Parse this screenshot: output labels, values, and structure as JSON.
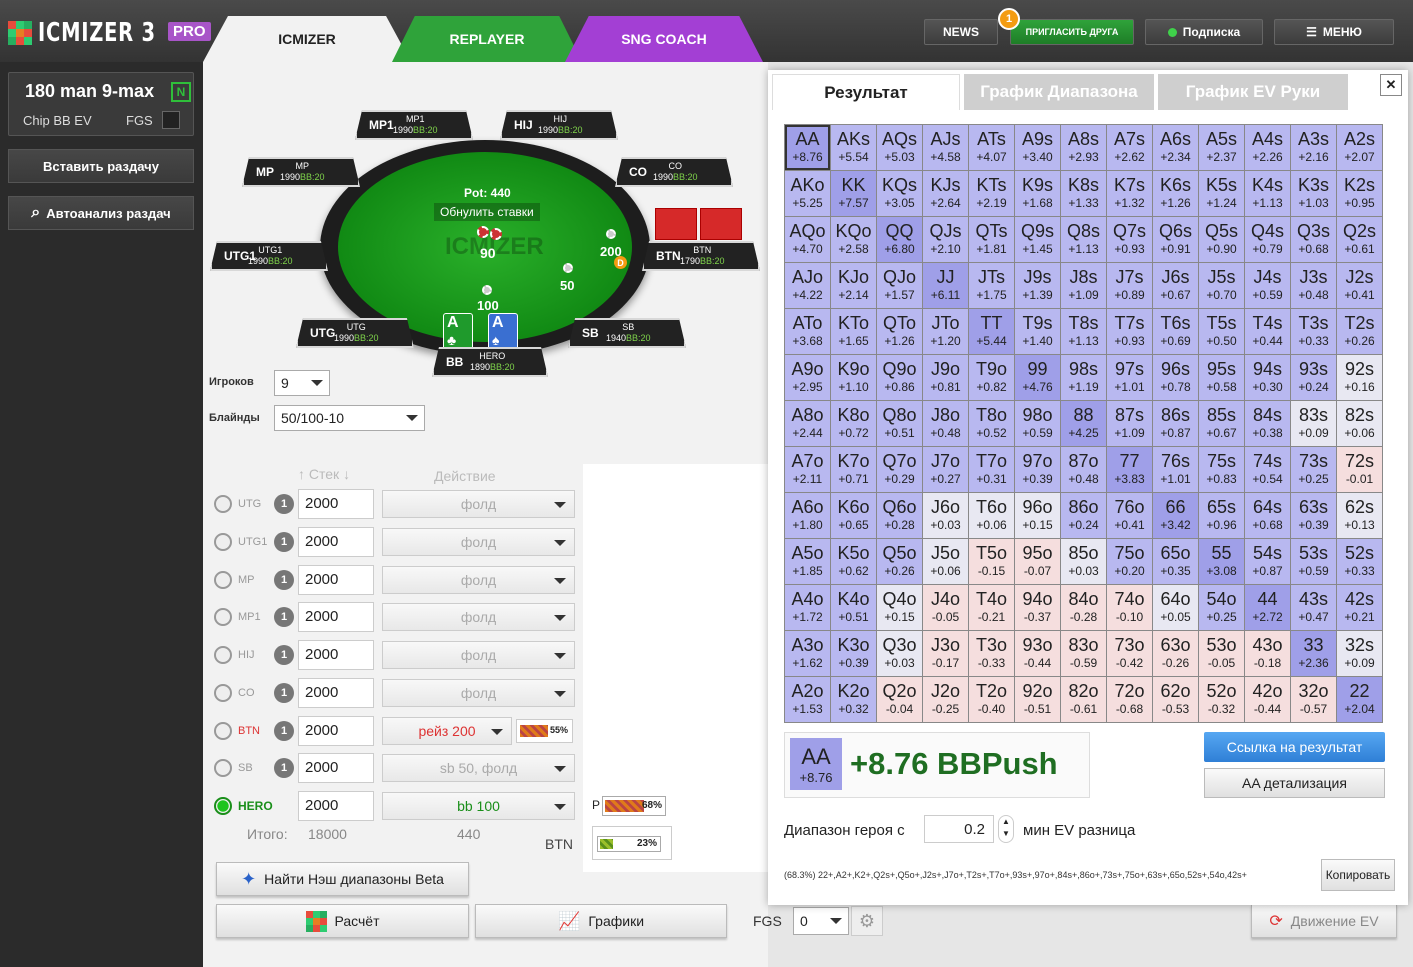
{
  "app": {
    "logo": "ICMIZER 3",
    "pro": "PRO"
  },
  "tabs": [
    "ICMIZER",
    "REPLAYER",
    "SNG COACH"
  ],
  "topbar": {
    "news": "NEWS",
    "invite": "ПРИГЛАСИТЬ ДРУГА",
    "invite_badge": "1",
    "subscribe": "Подписка",
    "menu": "МЕНЮ"
  },
  "sidebar": {
    "tournament": "180 man 9-max",
    "tournament_tag": "N",
    "chip_ev": "Chip BB EV",
    "fgs": "FGS",
    "paste": "Вставить раздачу",
    "autoanalysis": "Автоанализ раздач"
  },
  "table": {
    "pot": "Pot: 440",
    "reset": "Обнулить ставки",
    "watermark": "ICMIZER",
    "seats": [
      {
        "pos": "MP1",
        "name": "MP1",
        "stack": "1990",
        "bb": "BB:20"
      },
      {
        "pos": "HIJ",
        "name": "HIJ",
        "stack": "1990",
        "bb": "BB:20"
      },
      {
        "pos": "MP",
        "name": "MP",
        "stack": "1990",
        "bb": "BB:20"
      },
      {
        "pos": "CO",
        "name": "CO",
        "stack": "1990",
        "bb": "BB:20"
      },
      {
        "pos": "UTG1",
        "name": "UTG1",
        "stack": "1990",
        "bb": "BB:20"
      },
      {
        "pos": "BTN",
        "name": "BTN",
        "stack": "1790",
        "bb": "BB:20"
      },
      {
        "pos": "UTG",
        "name": "UTG",
        "stack": "1990",
        "bb": "BB:20"
      },
      {
        "pos": "SB",
        "name": "SB",
        "stack": "1940",
        "bb": "BB:20"
      },
      {
        "pos": "BB",
        "name": "HERO",
        "stack": "1890",
        "bb": "BB:20"
      }
    ],
    "chips": {
      "center": "90",
      "btn": "200",
      "sb": "50",
      "bb": "100"
    },
    "dealer": "D",
    "hero_cards": [
      {
        "rank": "A",
        "suit": "♣",
        "color": "#1f9a2c"
      },
      {
        "rank": "A",
        "suit": "♠",
        "color": "#3a6fd1"
      }
    ]
  },
  "settings": {
    "players_label": "Игроков",
    "players": "9",
    "blinds_label": "Блайнды",
    "blinds": "50/100-10",
    "stack_hdr": "Стек",
    "action_hdr": "Действие"
  },
  "players": [
    {
      "name": "UTG",
      "stack": "2000",
      "action": "фолд"
    },
    {
      "name": "UTG1",
      "stack": "2000",
      "action": "фолд"
    },
    {
      "name": "MP",
      "stack": "2000",
      "action": "фолд"
    },
    {
      "name": "MP1",
      "stack": "2000",
      "action": "фолд"
    },
    {
      "name": "HIJ",
      "stack": "2000",
      "action": "фолд"
    },
    {
      "name": "CO",
      "stack": "2000",
      "action": "фолд"
    },
    {
      "name": "BTN",
      "stack": "2000",
      "action": "рейз 200",
      "pct": "55%",
      "pct_val": 0.55
    },
    {
      "name": "SB",
      "stack": "2000",
      "action": "sb 50, фолд"
    },
    {
      "name": "HERO",
      "stack": "2000",
      "action": "bb 100"
    }
  ],
  "totals": {
    "label": "Итого:",
    "stack": "18000",
    "pot": "440"
  },
  "mini": {
    "p_label": "P",
    "p_pct": "68%",
    "p_val": 0.68,
    "btn_label": "BTN",
    "btn_pct": "23%",
    "btn_val": 0.23
  },
  "buttons": {
    "nash": "Найти Нэш диапазоны Beta",
    "calc": "Расчёт",
    "graphs": "Графики",
    "fgs_label": "FGS",
    "fgs_val": "0",
    "ev_move": "Движение EV"
  },
  "panel": {
    "tabs": [
      "Результат",
      "График Диапазона",
      "График EV Руки"
    ],
    "close": "✕",
    "hand": "AA",
    "hand_ev": "+8.76",
    "result": "+8.76 BBPush",
    "link_btn": "Ссылка на результат",
    "detail_btn": "AA детализация",
    "range_label": "Диапазон героя с",
    "range_val": "0.2",
    "range_suffix": "мин EV разница",
    "range_text": "(68.3%) 22+,A2+,K2+,Q2s+,Q5o+,J2s+,J7o+,T2s+,T7o+,93s+,97o+,84s+,86o+,73s+,75o+,63s+,65o,52s+,54o,42s+",
    "copy": "Копировать"
  },
  "grid": [
    [
      [
        "AA",
        "+8.76"
      ],
      [
        "AKs",
        "+5.54"
      ],
      [
        "AQs",
        "+5.03"
      ],
      [
        "AJs",
        "+4.58"
      ],
      [
        "ATs",
        "+4.07"
      ],
      [
        "A9s",
        "+3.40"
      ],
      [
        "A8s",
        "+2.93"
      ],
      [
        "A7s",
        "+2.62"
      ],
      [
        "A6s",
        "+2.34"
      ],
      [
        "A5s",
        "+2.37"
      ],
      [
        "A4s",
        "+2.26"
      ],
      [
        "A3s",
        "+2.16"
      ],
      [
        "A2s",
        "+2.07"
      ]
    ],
    [
      [
        "AKo",
        "+5.25"
      ],
      [
        "KK",
        "+7.57"
      ],
      [
        "KQs",
        "+3.05"
      ],
      [
        "KJs",
        "+2.64"
      ],
      [
        "KTs",
        "+2.19"
      ],
      [
        "K9s",
        "+1.68"
      ],
      [
        "K8s",
        "+1.33"
      ],
      [
        "K7s",
        "+1.32"
      ],
      [
        "K6s",
        "+1.26"
      ],
      [
        "K5s",
        "+1.24"
      ],
      [
        "K4s",
        "+1.13"
      ],
      [
        "K3s",
        "+1.03"
      ],
      [
        "K2s",
        "+0.95"
      ]
    ],
    [
      [
        "AQo",
        "+4.70"
      ],
      [
        "KQo",
        "+2.58"
      ],
      [
        "QQ",
        "+6.80"
      ],
      [
        "QJs",
        "+2.10"
      ],
      [
        "QTs",
        "+1.81"
      ],
      [
        "Q9s",
        "+1.45"
      ],
      [
        "Q8s",
        "+1.13"
      ],
      [
        "Q7s",
        "+0.93"
      ],
      [
        "Q6s",
        "+0.91"
      ],
      [
        "Q5s",
        "+0.90"
      ],
      [
        "Q4s",
        "+0.79"
      ],
      [
        "Q3s",
        "+0.68"
      ],
      [
        "Q2s",
        "+0.61"
      ]
    ],
    [
      [
        "AJo",
        "+4.22"
      ],
      [
        "KJo",
        "+2.14"
      ],
      [
        "QJo",
        "+1.57"
      ],
      [
        "JJ",
        "+6.11"
      ],
      [
        "JTs",
        "+1.75"
      ],
      [
        "J9s",
        "+1.39"
      ],
      [
        "J8s",
        "+1.09"
      ],
      [
        "J7s",
        "+0.89"
      ],
      [
        "J6s",
        "+0.67"
      ],
      [
        "J5s",
        "+0.70"
      ],
      [
        "J4s",
        "+0.59"
      ],
      [
        "J3s",
        "+0.48"
      ],
      [
        "J2s",
        "+0.41"
      ]
    ],
    [
      [
        "ATo",
        "+3.68"
      ],
      [
        "KTo",
        "+1.65"
      ],
      [
        "QTo",
        "+1.26"
      ],
      [
        "JTo",
        "+1.20"
      ],
      [
        "TT",
        "+5.44"
      ],
      [
        "T9s",
        "+1.40"
      ],
      [
        "T8s",
        "+1.13"
      ],
      [
        "T7s",
        "+0.93"
      ],
      [
        "T6s",
        "+0.69"
      ],
      [
        "T5s",
        "+0.50"
      ],
      [
        "T4s",
        "+0.44"
      ],
      [
        "T3s",
        "+0.33"
      ],
      [
        "T2s",
        "+0.26"
      ]
    ],
    [
      [
        "A9o",
        "+2.95"
      ],
      [
        "K9o",
        "+1.10"
      ],
      [
        "Q9o",
        "+0.86"
      ],
      [
        "J9o",
        "+0.81"
      ],
      [
        "T9o",
        "+0.82"
      ],
      [
        "99",
        "+4.76"
      ],
      [
        "98s",
        "+1.19"
      ],
      [
        "97s",
        "+1.01"
      ],
      [
        "96s",
        "+0.78"
      ],
      [
        "95s",
        "+0.58"
      ],
      [
        "94s",
        "+0.30"
      ],
      [
        "93s",
        "+0.24"
      ],
      [
        "92s",
        "+0.16"
      ]
    ],
    [
      [
        "A8o",
        "+2.44"
      ],
      [
        "K8o",
        "+0.72"
      ],
      [
        "Q8o",
        "+0.51"
      ],
      [
        "J8o",
        "+0.48"
      ],
      [
        "T8o",
        "+0.52"
      ],
      [
        "98o",
        "+0.59"
      ],
      [
        "88",
        "+4.25"
      ],
      [
        "87s",
        "+1.09"
      ],
      [
        "86s",
        "+0.87"
      ],
      [
        "85s",
        "+0.67"
      ],
      [
        "84s",
        "+0.38"
      ],
      [
        "83s",
        "+0.09"
      ],
      [
        "82s",
        "+0.06"
      ]
    ],
    [
      [
        "A7o",
        "+2.11"
      ],
      [
        "K7o",
        "+0.71"
      ],
      [
        "Q7o",
        "+0.29"
      ],
      [
        "J7o",
        "+0.27"
      ],
      [
        "T7o",
        "+0.31"
      ],
      [
        "97o",
        "+0.39"
      ],
      [
        "87o",
        "+0.48"
      ],
      [
        "77",
        "+3.83"
      ],
      [
        "76s",
        "+1.01"
      ],
      [
        "75s",
        "+0.83"
      ],
      [
        "74s",
        "+0.54"
      ],
      [
        "73s",
        "+0.25"
      ],
      [
        "72s",
        "-0.01"
      ]
    ],
    [
      [
        "A6o",
        "+1.80"
      ],
      [
        "K6o",
        "+0.65"
      ],
      [
        "Q6o",
        "+0.28"
      ],
      [
        "J6o",
        "+0.03"
      ],
      [
        "T6o",
        "+0.06"
      ],
      [
        "96o",
        "+0.15"
      ],
      [
        "86o",
        "+0.24"
      ],
      [
        "76o",
        "+0.41"
      ],
      [
        "66",
        "+3.42"
      ],
      [
        "65s",
        "+0.96"
      ],
      [
        "64s",
        "+0.68"
      ],
      [
        "63s",
        "+0.39"
      ],
      [
        "62s",
        "+0.13"
      ]
    ],
    [
      [
        "A5o",
        "+1.85"
      ],
      [
        "K5o",
        "+0.62"
      ],
      [
        "Q5o",
        "+0.26"
      ],
      [
        "J5o",
        "+0.06"
      ],
      [
        "T5o",
        "-0.15"
      ],
      [
        "95o",
        "-0.07"
      ],
      [
        "85o",
        "+0.03"
      ],
      [
        "75o",
        "+0.20"
      ],
      [
        "65o",
        "+0.35"
      ],
      [
        "55",
        "+3.08"
      ],
      [
        "54s",
        "+0.87"
      ],
      [
        "53s",
        "+0.59"
      ],
      [
        "52s",
        "+0.33"
      ]
    ],
    [
      [
        "A4o",
        "+1.72"
      ],
      [
        "K4o",
        "+0.51"
      ],
      [
        "Q4o",
        "+0.15"
      ],
      [
        "J4o",
        "-0.05"
      ],
      [
        "T4o",
        "-0.21"
      ],
      [
        "94o",
        "-0.37"
      ],
      [
        "84o",
        "-0.28"
      ],
      [
        "74o",
        "-0.10"
      ],
      [
        "64o",
        "+0.05"
      ],
      [
        "54o",
        "+0.25"
      ],
      [
        "44",
        "+2.72"
      ],
      [
        "43s",
        "+0.47"
      ],
      [
        "42s",
        "+0.21"
      ]
    ],
    [
      [
        "A3o",
        "+1.62"
      ],
      [
        "K3o",
        "+0.39"
      ],
      [
        "Q3o",
        "+0.03"
      ],
      [
        "J3o",
        "-0.17"
      ],
      [
        "T3o",
        "-0.33"
      ],
      [
        "93o",
        "-0.44"
      ],
      [
        "83o",
        "-0.59"
      ],
      [
        "73o",
        "-0.42"
      ],
      [
        "63o",
        "-0.26"
      ],
      [
        "53o",
        "-0.05"
      ],
      [
        "43o",
        "-0.18"
      ],
      [
        "33",
        "+2.36"
      ],
      [
        "32s",
        "+0.09"
      ]
    ],
    [
      [
        "A2o",
        "+1.53"
      ],
      [
        "K2o",
        "+0.32"
      ],
      [
        "Q2o",
        "-0.04"
      ],
      [
        "J2o",
        "-0.25"
      ],
      [
        "T2o",
        "-0.40"
      ],
      [
        "92o",
        "-0.51"
      ],
      [
        "82o",
        "-0.61"
      ],
      [
        "72o",
        "-0.68"
      ],
      [
        "62o",
        "-0.53"
      ],
      [
        "52o",
        "-0.32"
      ],
      [
        "42o",
        "-0.44"
      ],
      [
        "32o",
        "-0.57"
      ],
      [
        "22",
        "+2.04"
      ]
    ]
  ],
  "colors": {
    "push": "#b8b8f0",
    "pair": "#9f9fe8",
    "fold": "#f5dede",
    "neutral": "#e8e8f2",
    "green_text": "#1f6e22",
    "accent_blue": "#3a8ee6"
  }
}
